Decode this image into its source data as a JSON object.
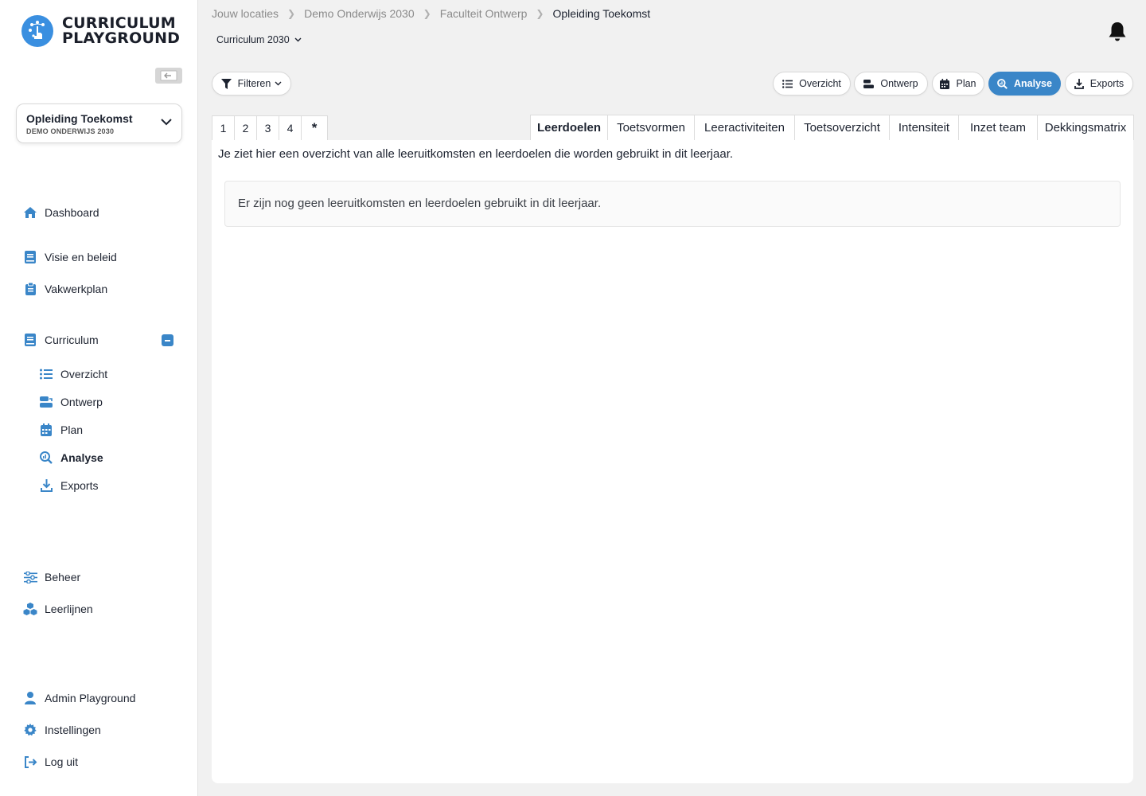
{
  "brand": {
    "line1": "CURRICULUM",
    "line2": "PLAYGROUND"
  },
  "program": {
    "title": "Opleiding Toekomst",
    "subtitle": "DEMO ONDERWIJS 2030"
  },
  "nav": {
    "dashboard": "Dashboard",
    "visie": "Visie en beleid",
    "vakwerkplan": "Vakwerkplan",
    "curriculum": "Curriculum",
    "sub": {
      "overzicht": "Overzicht",
      "ontwerp": "Ontwerp",
      "plan": "Plan",
      "analyse": "Analyse",
      "exports": "Exports"
    },
    "beheer": "Beheer",
    "leerlijnen": "Leerlijnen",
    "admin": "Admin Playground",
    "instellingen": "Instellingen",
    "logout": "Log uit"
  },
  "breadcrumb": [
    "Jouw locaties",
    "Demo Onderwijs 2030",
    "Faculteit Ontwerp",
    "Opleiding Toekomst"
  ],
  "curriculum_select": "Curriculum 2030",
  "toolbar": {
    "filter": "Filteren",
    "overzicht": "Overzicht",
    "ontwerp": "Ontwerp",
    "plan": "Plan",
    "analyse": "Analyse",
    "exports": "Exports"
  },
  "year_tabs": [
    "1",
    "2",
    "3",
    "4",
    "*"
  ],
  "view_tabs": [
    "Leerdoelen",
    "Toetsvormen",
    "Leeractiviteiten",
    "Toetsoverzicht",
    "Intensiteit",
    "Inzet team",
    "Dekkingsmatrix"
  ],
  "active_view_tab": "Leerdoelen",
  "content": {
    "description": "Je ziet hier een overzicht van alle leeruitkomsten en leerdoelen die worden gebruikt in dit leerjaar.",
    "empty_message": "Er zijn nog geen leeruitkomsten en leerdoelen gebruikt in dit leerjaar."
  },
  "colors": {
    "accent": "#3a86c8",
    "logo": "#3a8fe0",
    "background": "#f1f1f1"
  }
}
